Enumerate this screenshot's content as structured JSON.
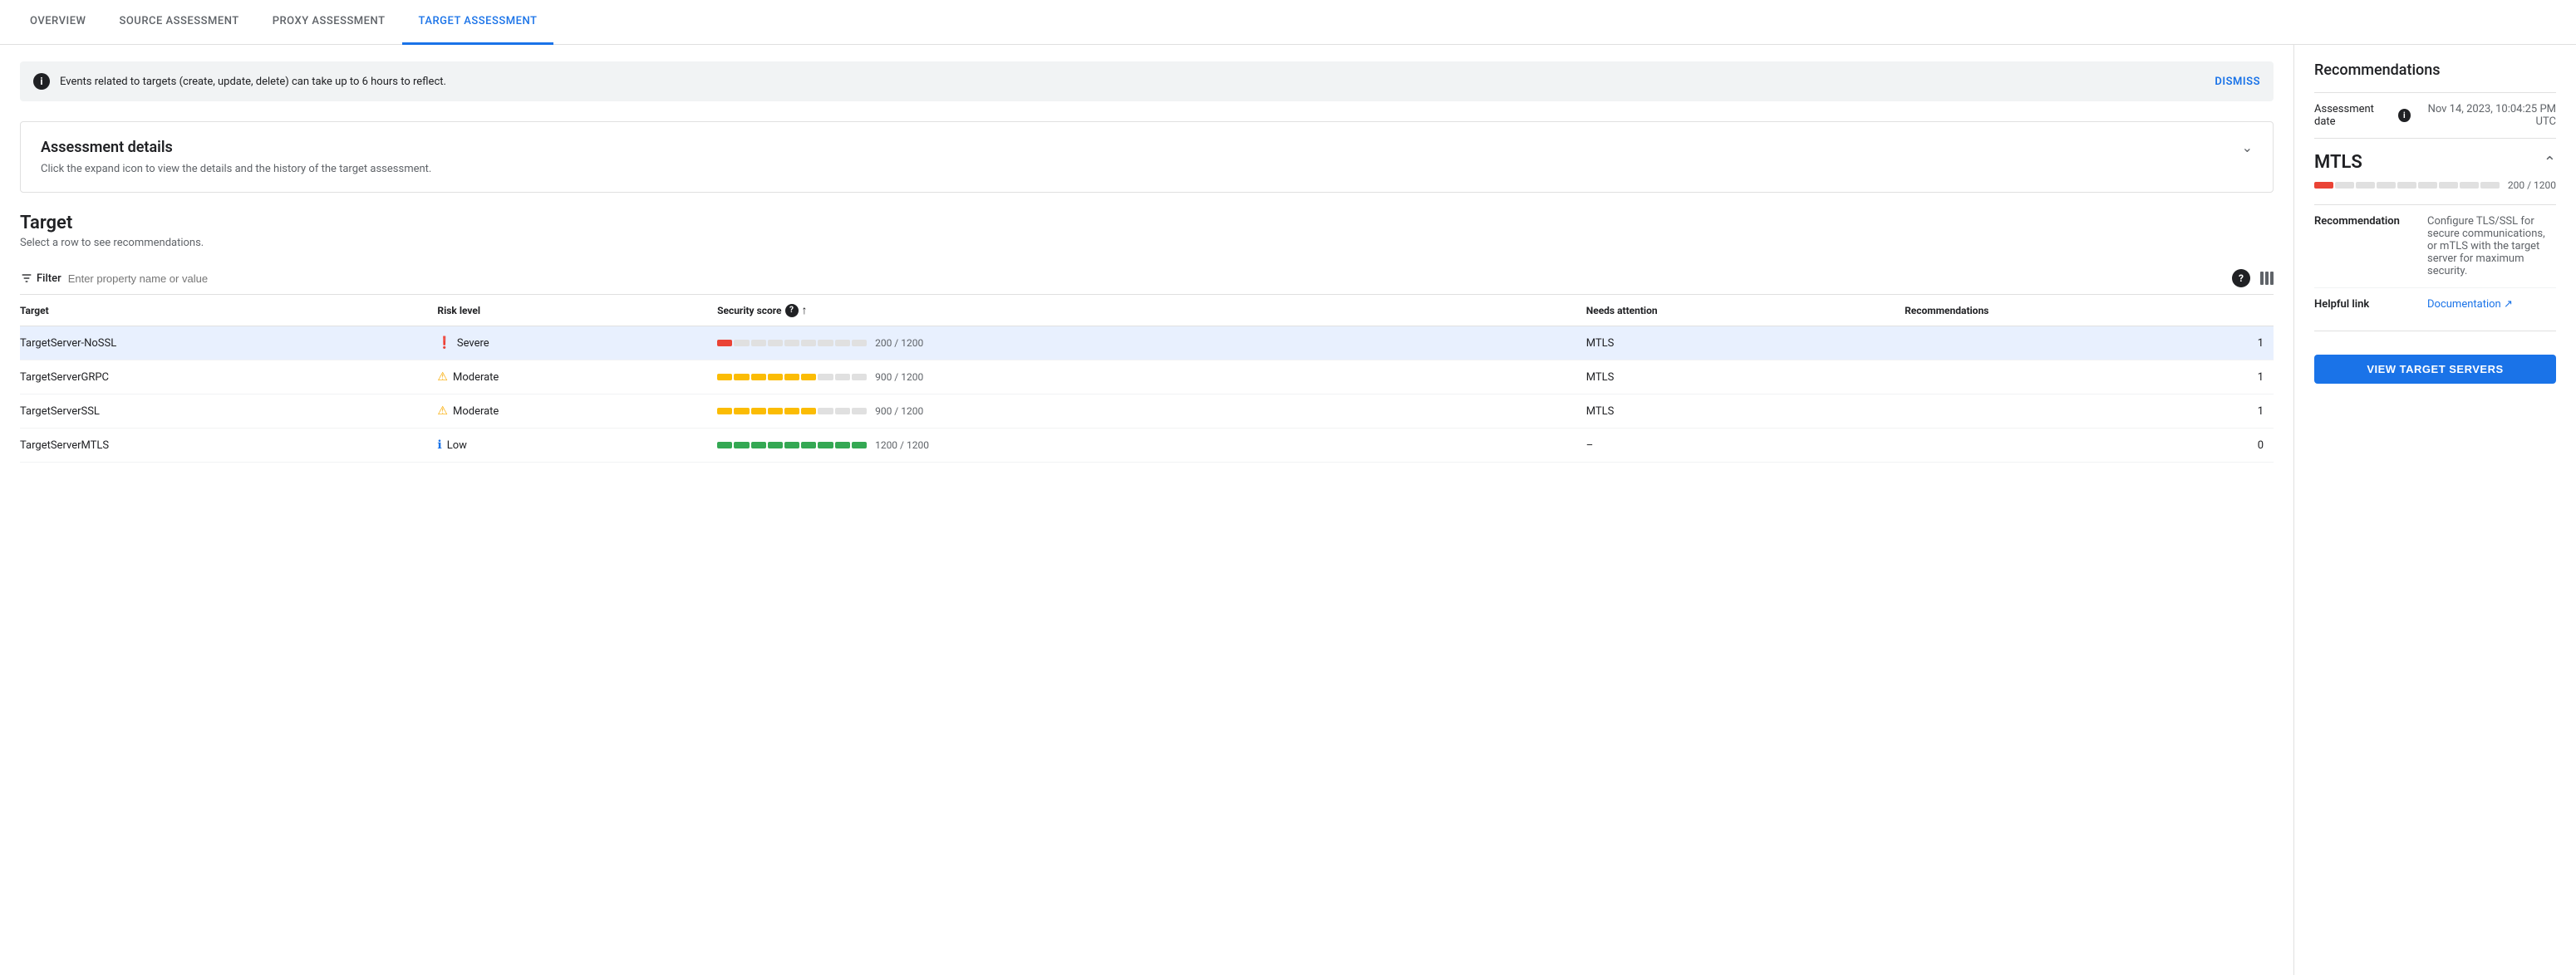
{
  "nav": {
    "tabs": [
      {
        "id": "overview",
        "label": "OVERVIEW",
        "active": false
      },
      {
        "id": "source",
        "label": "SOURCE ASSESSMENT",
        "active": false
      },
      {
        "id": "proxy",
        "label": "PROXY ASSESSMENT",
        "active": false
      },
      {
        "id": "target",
        "label": "TARGET ASSESSMENT",
        "active": true
      }
    ]
  },
  "banner": {
    "text": "Events related to targets (create, update, delete) can take up to 6 hours to reflect.",
    "dismiss_label": "DISMISS",
    "info_icon": "i"
  },
  "assessment_details": {
    "title": "Assessment details",
    "description": "Click the expand icon to view the details and the history of the target assessment."
  },
  "target_section": {
    "title": "Target",
    "subtitle": "Select a row to see recommendations.",
    "filter_placeholder": "Enter property name or value",
    "filter_label": "Filter",
    "columns": {
      "target": "Target",
      "risk_level": "Risk level",
      "security_score": "Security score",
      "needs_attention": "Needs attention",
      "recommendations": "Recommendations"
    },
    "rows": [
      {
        "id": "row1",
        "target": "TargetServer-NoSSL",
        "risk_level": "Severe",
        "risk_icon": "❗",
        "risk_color": "#d93025",
        "score_value": "200 / 1200",
        "score_filled": 1,
        "score_total": 9,
        "score_color": "#ea4335",
        "needs_attention": "MTLS",
        "recommendations": "1",
        "selected": true
      },
      {
        "id": "row2",
        "target": "TargetServerGRPC",
        "risk_level": "Moderate",
        "risk_icon": "⚠",
        "risk_color": "#f9ab00",
        "score_value": "900 / 1200",
        "score_filled": 6,
        "score_total": 9,
        "score_color": "#fbbc04",
        "needs_attention": "MTLS",
        "recommendations": "1",
        "selected": false
      },
      {
        "id": "row3",
        "target": "TargetServerSSL",
        "risk_level": "Moderate",
        "risk_icon": "⚠",
        "risk_color": "#f9ab00",
        "score_value": "900 / 1200",
        "score_filled": 6,
        "score_total": 9,
        "score_color": "#fbbc04",
        "needs_attention": "MTLS",
        "recommendations": "1",
        "selected": false
      },
      {
        "id": "row4",
        "target": "TargetServerMTLS",
        "risk_level": "Low",
        "risk_icon": "ℹ",
        "risk_color": "#1a73e8",
        "score_value": "1200 / 1200",
        "score_filled": 9,
        "score_total": 9,
        "score_color": "#34a853",
        "needs_attention": "–",
        "recommendations": "0",
        "selected": false
      }
    ]
  },
  "sidebar": {
    "title": "Recommendations",
    "assessment_date_label": "Assessment date",
    "assessment_date_value": "Nov 14, 2023, 10:04:25 PM UTC",
    "info_icon": "i",
    "mtls": {
      "title": "MTLS",
      "score_value": "200 / 1200",
      "score_filled": 1,
      "score_total": 9,
      "score_color": "#ea4335",
      "recommendation_label": "Recommendation",
      "recommendation_value": "Configure TLS/SSL for secure communications, or mTLS with the target server for maximum security.",
      "helpful_link_label": "Helpful link",
      "helpful_link_text": "Documentation ↗"
    },
    "view_btn_label": "VIEW TARGET SERVERS"
  }
}
